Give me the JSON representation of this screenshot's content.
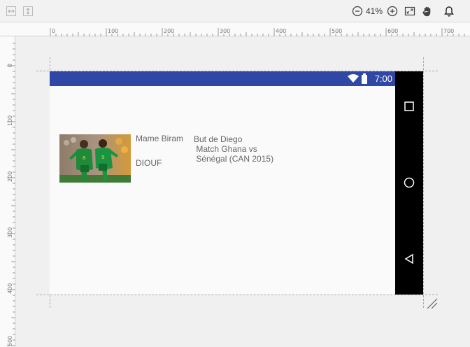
{
  "toolbar": {
    "zoom_level": "41%",
    "icons": [
      "expand-horizontal-icon",
      "expand-vertical-icon",
      "zoom-out-icon",
      "zoom-in-icon",
      "zoom-to-fit-icon",
      "pan-hand-icon",
      "notification-bell-icon"
    ]
  },
  "ruler": {
    "h_ticks": [
      "0",
      "100",
      "200",
      "300",
      "400",
      "500",
      "600",
      "700"
    ],
    "v_ticks": [
      "0",
      "100",
      "200",
      "300",
      "400",
      "500"
    ]
  },
  "device": {
    "status_time": "7:00",
    "status_color": "#3048a5",
    "nav_icons": [
      "recent-apps-icon",
      "home-icon",
      "back-icon"
    ]
  },
  "item": {
    "name_line1": "Mame Biram",
    "name_line2": "DIOUF",
    "desc_line1": "But de Diego",
    "desc_line2": " Match Ghana vs",
    "desc_line3": " Sénégal (CAN 2015)"
  }
}
